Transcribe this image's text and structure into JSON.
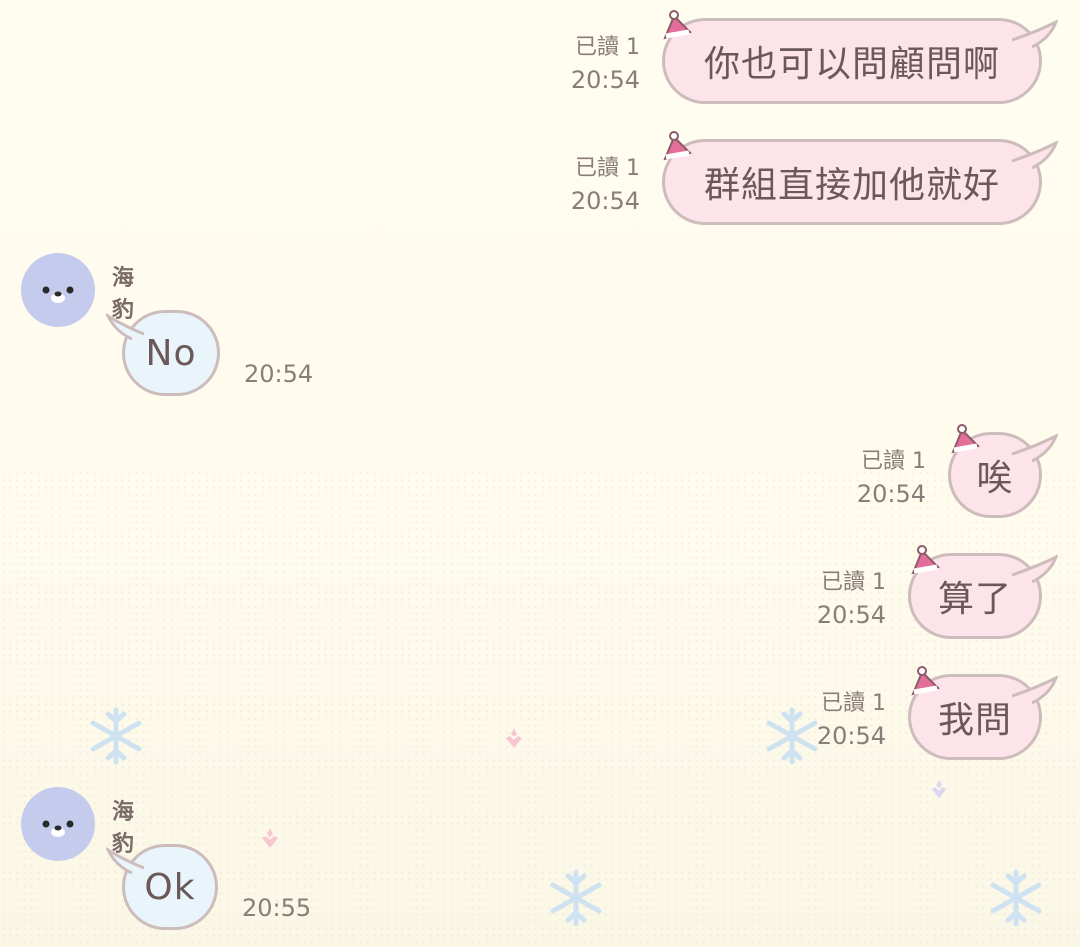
{
  "chat": {
    "messages": [
      {
        "text": "你也可以問顧問啊",
        "read": "已讀 1",
        "time": "20:54"
      },
      {
        "text": "群組直接加他就好",
        "read": "已讀 1",
        "time": "20:54"
      },
      {
        "sender": "海豹",
        "text": "No",
        "time": "20:54"
      },
      {
        "text": "唉",
        "read": "已讀 1",
        "time": "20:54"
      },
      {
        "text": "算了",
        "read": "已讀 1",
        "time": "20:54"
      },
      {
        "text": "我問",
        "read": "已讀 1",
        "time": "20:54"
      },
      {
        "sender": "海豹",
        "text": "Ok",
        "time": "20:55"
      }
    ]
  },
  "colors": {
    "outgoing_bubble": "#fde3ea",
    "incoming_bubble": "#e9f4fb",
    "bubble_border": "#cdbcbc",
    "avatar": "#c5cbec",
    "background": "#fffdf0"
  },
  "icons": {
    "avatar": "seal-face-icon",
    "bubble_decoration": "santa-hat-icon",
    "background": "snowflake-icon"
  }
}
